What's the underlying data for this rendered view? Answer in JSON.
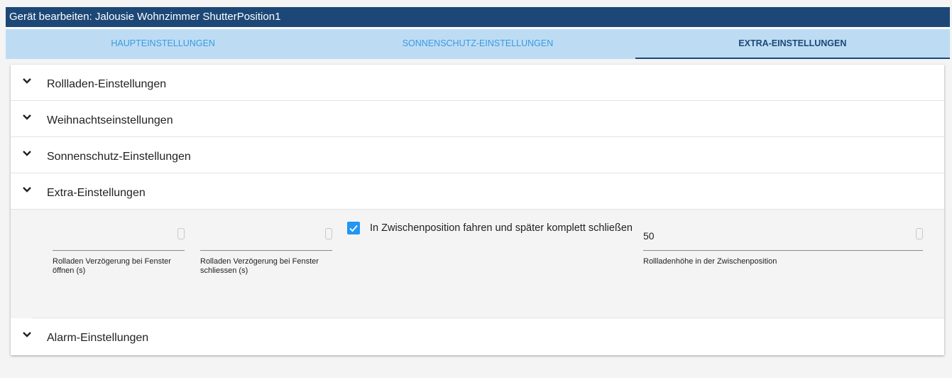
{
  "window": {
    "title": "Gerät bearbeiten: Jalousie Wohnzimmer ShutterPosition1"
  },
  "tabs": [
    {
      "label": "HAUPTEINSTELLUNGEN",
      "active": false
    },
    {
      "label": "SONNENSCHUTZ-EINSTELLUNGEN",
      "active": false
    },
    {
      "label": "EXTRA-EINSTELLUNGEN",
      "active": true
    }
  ],
  "sections": {
    "rollladen": {
      "label": "Rollladen-Einstellungen",
      "icon": "chevron-down-icon"
    },
    "weihnachten": {
      "label": "Weihnachtseinstellungen",
      "icon": "chevron-down-icon"
    },
    "sonnenschutz": {
      "label": "Sonnenschutz-Einstellungen",
      "icon": "chevron-down-icon"
    },
    "extra": {
      "label": "Extra-Einstellungen",
      "icon": "chevron-down-icon",
      "expanded": true
    },
    "alarm": {
      "label": "Alarm-Einstellungen",
      "icon": "chevron-down-icon"
    }
  },
  "extra_fields": {
    "delay_open": {
      "label": "Rolladen Verzögerung bei Fenster öffnen (s)",
      "value": ""
    },
    "delay_close": {
      "label": "Rolladen Verzögerung bei Fenster schliessen (s)",
      "value": ""
    },
    "intermediate": {
      "label": "In Zwischenposition fahren und später komplett schließen",
      "checked": true
    },
    "height": {
      "label": "Rollladenhöhe in der Zwischenposition",
      "value": "50"
    }
  },
  "colors": {
    "titlebar": "#1c4776",
    "tabs_bg": "#bddcf4",
    "tab_inactive": "#3a9ae0",
    "tab_active": "#1c4776",
    "checkbox": "#2196f3"
  }
}
